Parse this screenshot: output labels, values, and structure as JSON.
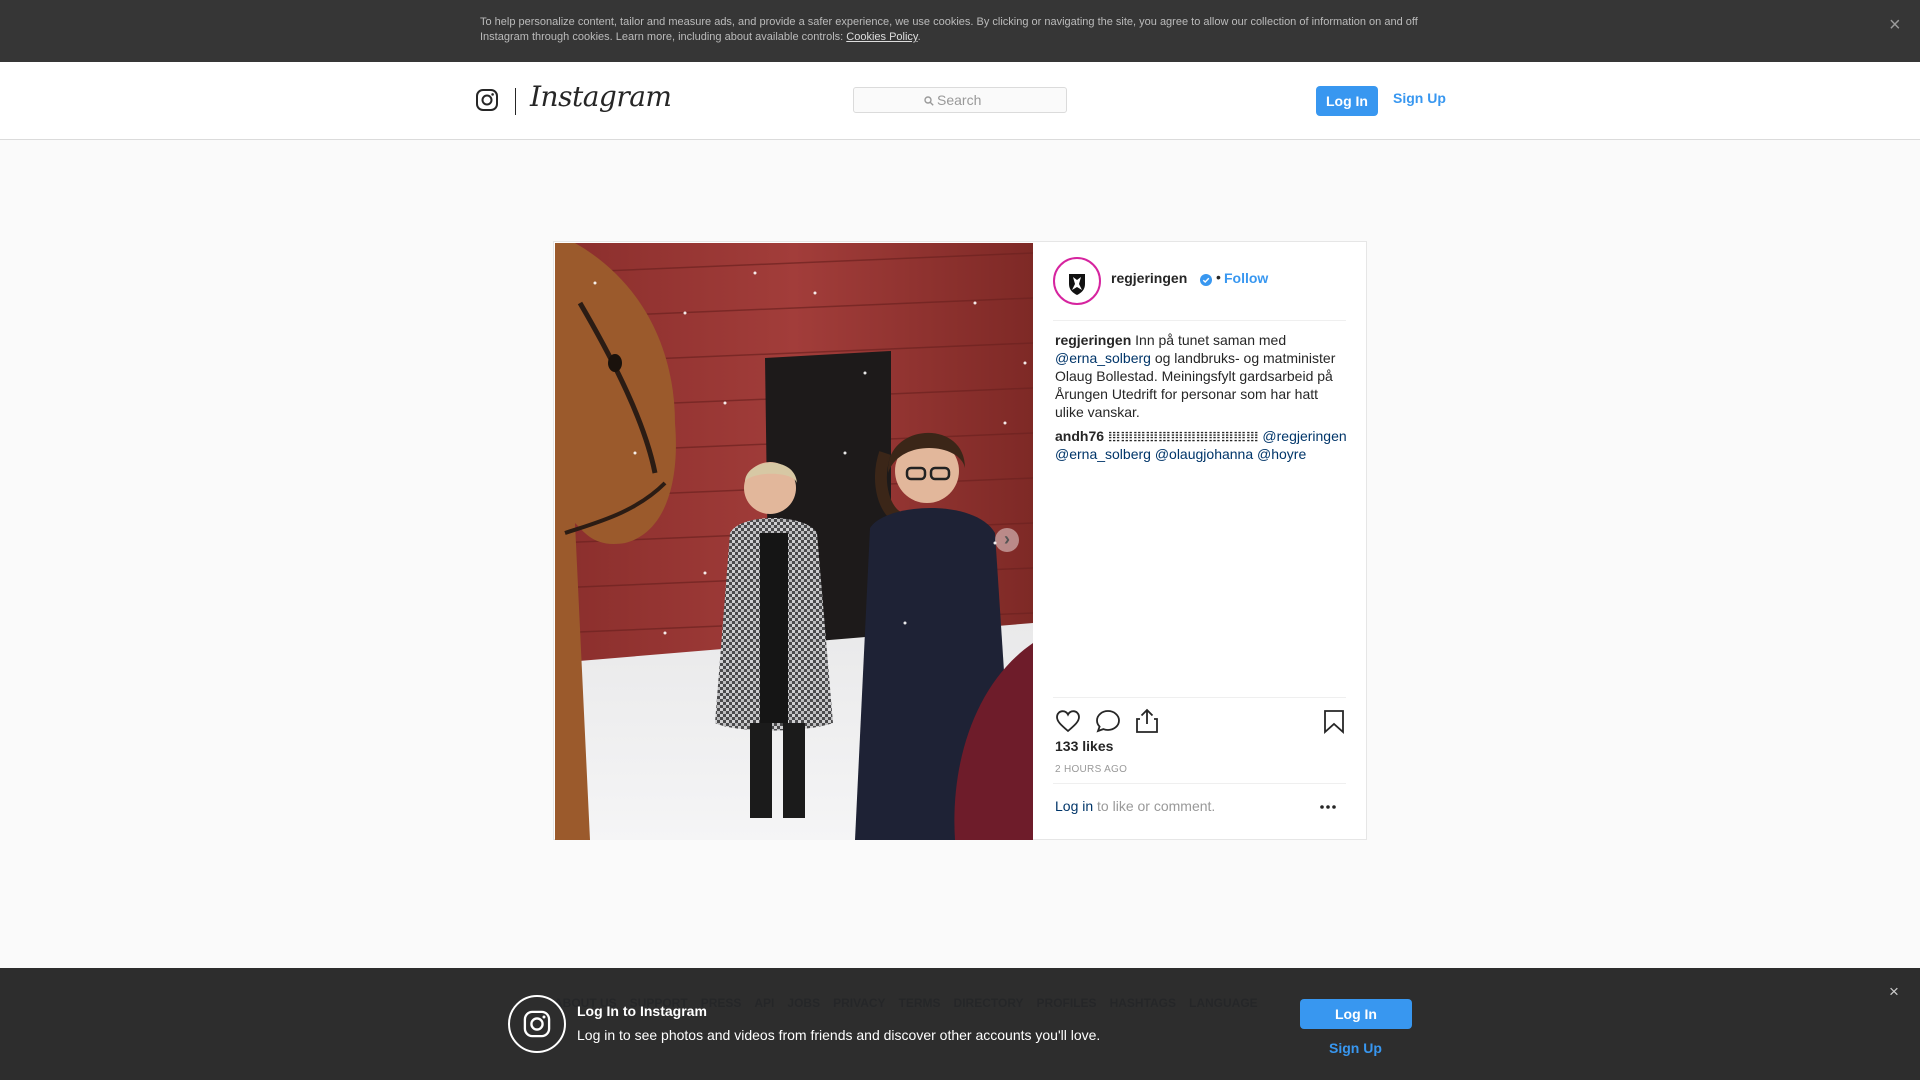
{
  "cookie_bar": {
    "text": "To help personalize content, tailor and measure ads, and provide a safer experience, we use cookies. By clicking or navigating the site, you agree to allow our collection of information on and off Instagram through cookies. Learn more, including about available controls: ",
    "link": "Cookies Policy",
    "period": ".",
    "close": "×"
  },
  "header": {
    "wordmark": "Instagram",
    "search_placeholder": "Search",
    "login": "Log In",
    "signup": "Sign Up"
  },
  "post": {
    "username": "regjeringen",
    "dot": "•",
    "follow": "Follow",
    "comments": [
      {
        "user": "regjeringen",
        "parts": [
          {
            "t": " Inn på tunet saman med "
          },
          {
            "t": "@erna_solberg",
            "m": true
          },
          {
            "t": " og landbruks- og matminister Olaug Bollestad. Meiningsfylt gardsarbeid på Årungen Utedrift for personar som har hatt ulike vanskar."
          }
        ]
      },
      {
        "user": "andh76",
        "parts": [
          {
            "t": " 𝍖𝍖𝍖𝍖𝍖𝍖𝍖𝍖𝍖𝍖𝍖𝍖 "
          },
          {
            "t": "@regjeringen",
            "m": true
          },
          {
            "t": " "
          },
          {
            "t": "@erna_solberg",
            "m": true
          },
          {
            "t": " "
          },
          {
            "t": "@olaugjohanna",
            "m": true
          },
          {
            "t": " "
          },
          {
            "t": "@hoyre",
            "m": true
          }
        ]
      }
    ],
    "likes": "133 likes",
    "time": "2 HOURS AGO",
    "login_link": "Log in",
    "login_suffix": " to like or comment."
  },
  "footer": {
    "links": [
      "ABOUT US",
      "SUPPORT",
      "PRESS",
      "API",
      "JOBS",
      "PRIVACY",
      "TERMS",
      "DIRECTORY",
      "PROFILES",
      "HASHTAGS",
      "LANGUAGE"
    ]
  },
  "login_banner": {
    "title": "Log In to Instagram",
    "subtitle": "Log in to see photos and videos from friends and discover other accounts you'll love.",
    "login": "Log In",
    "signup": "Sign Up",
    "close": "×"
  },
  "colors": {
    "accent": "#3897f0",
    "mention": "#003569",
    "cookie_bg": "#363636",
    "banner_bg": "#262626"
  },
  "icons": [
    "camera-logo-icon",
    "search-icon",
    "verified-icon",
    "heart-icon",
    "comment-icon",
    "share-icon",
    "bookmark-icon",
    "more-icon",
    "chevron-right-icon",
    "close-icon"
  ]
}
